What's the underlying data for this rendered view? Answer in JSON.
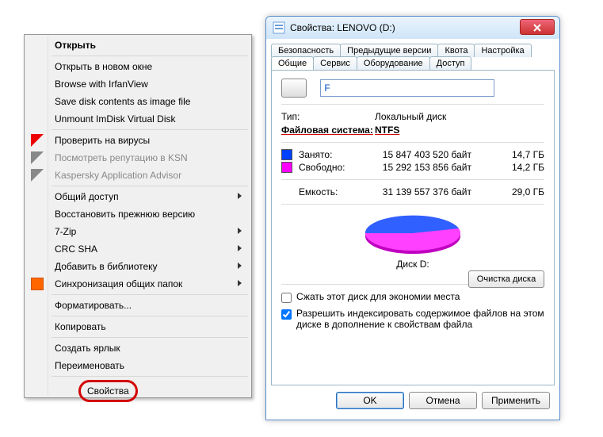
{
  "context_menu": {
    "items": [
      {
        "label": "Открыть",
        "bold": true
      },
      {
        "sep": true
      },
      {
        "label": "Открыть в новом окне"
      },
      {
        "label": "Browse with IrfanView"
      },
      {
        "label": "Save disk contents as image file"
      },
      {
        "label": "Unmount ImDisk Virtual Disk"
      },
      {
        "sep": true
      },
      {
        "label": "Проверить на вирусы",
        "icon": "k"
      },
      {
        "label": "Посмотреть репутацию в KSN",
        "icon": "kg",
        "disabled": true
      },
      {
        "label": "Kaspersky Application Advisor",
        "icon": "kg",
        "disabled": true
      },
      {
        "sep": true
      },
      {
        "label": "Общий доступ",
        "sub": true
      },
      {
        "label": "Восстановить прежнюю версию"
      },
      {
        "label": "7-Zip",
        "sub": true
      },
      {
        "label": "CRC SHA",
        "sub": true
      },
      {
        "label": "Добавить в библиотеку",
        "sub": true
      },
      {
        "label": "Синхронизация общих папок",
        "icon": "s",
        "sub": true
      },
      {
        "sep": true
      },
      {
        "label": "Форматировать..."
      },
      {
        "sep": true
      },
      {
        "label": "Копировать"
      },
      {
        "sep": true
      },
      {
        "label": "Создать ярлык"
      },
      {
        "label": "Переименовать"
      },
      {
        "sep": true
      }
    ],
    "highlight": "Свойства"
  },
  "window": {
    "title": "Свойства: LENOVO (D:)",
    "tabs_top": [
      "Безопасность",
      "Предыдущие версии",
      "Квота",
      "Настройка"
    ],
    "tabs_bottom": [
      "Общие",
      "Сервис",
      "Оборудование",
      "Доступ"
    ],
    "active_tab": "Общие",
    "volume_value": "F",
    "type_label": "Тип:",
    "type_value": "Локальный диск",
    "fs_label": "Файловая система:",
    "fs_value": "NTFS",
    "used": {
      "swatch": "#0040ff",
      "label": "Занято:",
      "bytes": "15 847 403 520 байт",
      "gb": "14,7 ГБ"
    },
    "free": {
      "swatch": "#ff00ff",
      "label": "Свободно:",
      "bytes": "15 292 153 856 байт",
      "gb": "14,2 ГБ"
    },
    "capacity": {
      "label": "Емкость:",
      "bytes": "31 139 557 376 байт",
      "gb": "29,0 ГБ"
    },
    "disk_label": "Диск D:",
    "cleanup_btn": "Очистка диска",
    "compress_label": "Сжать этот диск для экономии места",
    "index_label": "Разрешить индексировать содержимое файлов на этом диске в дополнение к свойствам файла",
    "index_checked": true,
    "buttons": {
      "ok": "OK",
      "cancel": "Отмена",
      "apply": "Применить"
    }
  },
  "chart_data": {
    "type": "pie",
    "title": "Диск D:",
    "series": [
      {
        "name": "Занято",
        "value": 15847403520,
        "display": "14,7 ГБ",
        "color": "#0040ff"
      },
      {
        "name": "Свободно",
        "value": 15292153856,
        "display": "14,2 ГБ",
        "color": "#ff00ff"
      }
    ],
    "total": {
      "value": 31139557376,
      "display": "29,0 ГБ"
    }
  }
}
